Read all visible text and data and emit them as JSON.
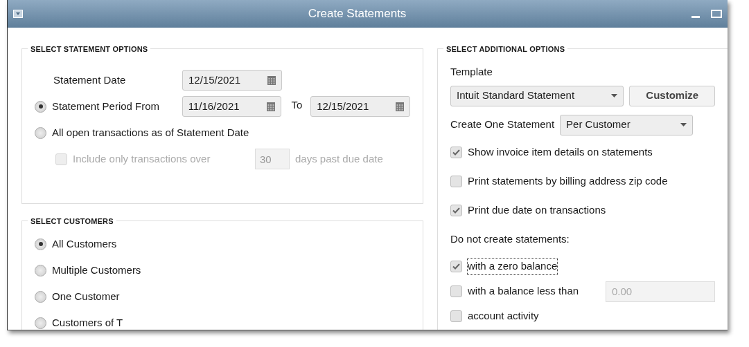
{
  "window": {
    "title": "Create Statements"
  },
  "statement_options": {
    "heading": "SELECT STATEMENT OPTIONS",
    "statement_date": {
      "label": "Statement Date",
      "value": "12/15/2021"
    },
    "modes": [
      {
        "kind": "period",
        "label": "Statement Period From",
        "selected": true,
        "from": "11/16/2021",
        "to_label": "To",
        "to": "12/15/2021"
      },
      {
        "kind": "open",
        "label": "All open transactions as of Statement Date",
        "selected": false
      }
    ],
    "overdue": {
      "label": "Include only transactions over",
      "checked": false,
      "disabled": true,
      "value": "30",
      "suffix": "days past due date"
    }
  },
  "customers": {
    "heading": "SELECT CUSTOMERS",
    "options": [
      {
        "label": "All Customers",
        "selected": true
      },
      {
        "label": "Multiple Customers",
        "selected": false
      },
      {
        "label": "One Customer",
        "selected": false
      },
      {
        "label": "Customers of T",
        "selected": false
      }
    ]
  },
  "additional": {
    "heading": "SELECT ADDITIONAL OPTIONS",
    "template_label": "Template",
    "template": "Intuit Standard Statement",
    "customize": "Customize",
    "create_label": "Create One Statement",
    "create_value": "Per Customer",
    "options": [
      {
        "label": "Show invoice item details on statements",
        "checked": true
      },
      {
        "label": "Print statements by billing address zip code",
        "checked": false
      },
      {
        "label": "Print due date on transactions",
        "checked": true
      }
    ],
    "skip_label": "Do not create statements:",
    "skip_options": [
      {
        "kind": "check",
        "label": "with a zero balance",
        "checked": true,
        "focused": true
      },
      {
        "kind": "amount",
        "label": "with a balance less than",
        "checked": false,
        "focused": false,
        "value": "0.00"
      },
      {
        "kind": "check",
        "label": "account activity",
        "checked": false,
        "focused": false
      }
    ]
  }
}
